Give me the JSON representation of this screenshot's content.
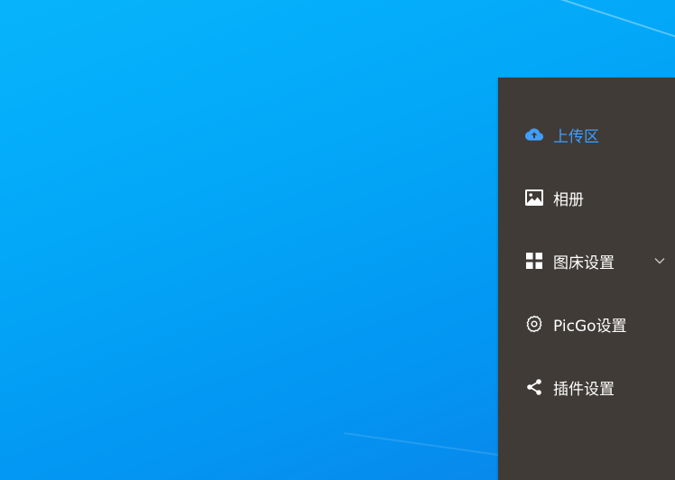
{
  "sidebar": {
    "items": [
      {
        "label": "上传区",
        "icon": "cloud-upload-icon",
        "active": true
      },
      {
        "label": "相册",
        "icon": "image-icon",
        "active": false
      },
      {
        "label": "图床设置",
        "icon": "grid-icon",
        "active": false,
        "expandable": true
      },
      {
        "label": "PicGo设置",
        "icon": "gear-icon",
        "active": false
      },
      {
        "label": "插件设置",
        "icon": "share-icon",
        "active": false
      }
    ]
  },
  "colors": {
    "sidebar_bg": "#403b36",
    "active_text": "#409eff",
    "text": "#ffffff",
    "desktop": "#03a8f8"
  }
}
